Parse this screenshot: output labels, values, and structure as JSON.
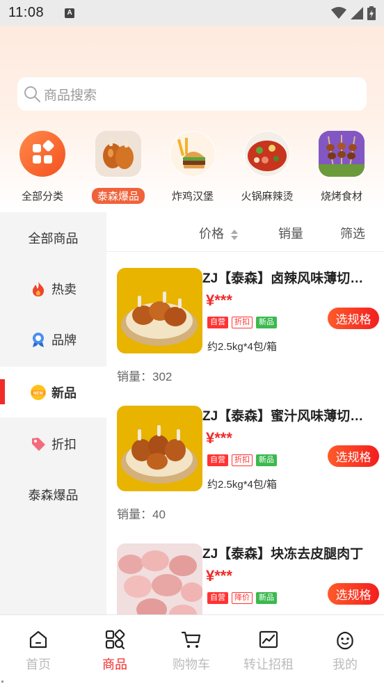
{
  "status": {
    "time": "11:08",
    "notif_icon": "A"
  },
  "search": {
    "placeholder": "商品搜索"
  },
  "categories": [
    {
      "label": "全部分类",
      "icon": "grid-icon",
      "active": false
    },
    {
      "label": "泰森爆品",
      "icon": "fried-chicken-image",
      "active": true
    },
    {
      "label": "炸鸡汉堡",
      "icon": "burger-image",
      "active": false
    },
    {
      "label": "火锅麻辣烫",
      "icon": "hotpot-image",
      "active": false
    },
    {
      "label": "烧烤食材",
      "icon": "skewer-image",
      "active": false
    }
  ],
  "sidebar": {
    "items": [
      {
        "label": "全部商品",
        "icon": ""
      },
      {
        "label": "热卖",
        "icon": "flame-icon"
      },
      {
        "label": "品牌",
        "icon": "badge-icon"
      },
      {
        "label": "新品",
        "icon": "new-icon",
        "active": true
      },
      {
        "label": "折扣",
        "icon": "tag-icon"
      },
      {
        "label": "泰森爆品",
        "icon": ""
      }
    ]
  },
  "sort": {
    "price": "价格",
    "sales": "销量",
    "filter": "筛选"
  },
  "products": [
    {
      "title": "ZJ【泰森】卤辣风味薄切鸡腿",
      "price": "¥***",
      "tags": [
        "自营",
        "折扣",
        "新品"
      ],
      "spec": "约2.5kg*4包/箱",
      "sales": "销量：302",
      "button": "选规格"
    },
    {
      "title": "ZJ【泰森】蜜汁风味薄切鸡腿",
      "price": "¥***",
      "tags": [
        "自营",
        "折扣",
        "新品"
      ],
      "spec": "约2.5kg*4包/箱",
      "sales": "销量：40",
      "button": "选规格"
    },
    {
      "title": "ZJ【泰森】块冻去皮腿肉丁",
      "price": "¥***",
      "tags": [
        "自营",
        "降价",
        "新品"
      ],
      "spec": "",
      "sales": "",
      "button": "选规格"
    }
  ],
  "tabbar": [
    {
      "label": "首页",
      "icon": "home-icon",
      "active": false
    },
    {
      "label": "商品",
      "icon": "goods-icon",
      "active": true
    },
    {
      "label": "购物车",
      "icon": "cart-icon",
      "active": false
    },
    {
      "label": "转让招租",
      "icon": "chart-icon",
      "active": false
    },
    {
      "label": "我的",
      "icon": "profile-icon",
      "active": false
    }
  ],
  "colors": {
    "accent": "#f12a2a",
    "orange": "#f0623a",
    "green": "#3cb94f"
  }
}
